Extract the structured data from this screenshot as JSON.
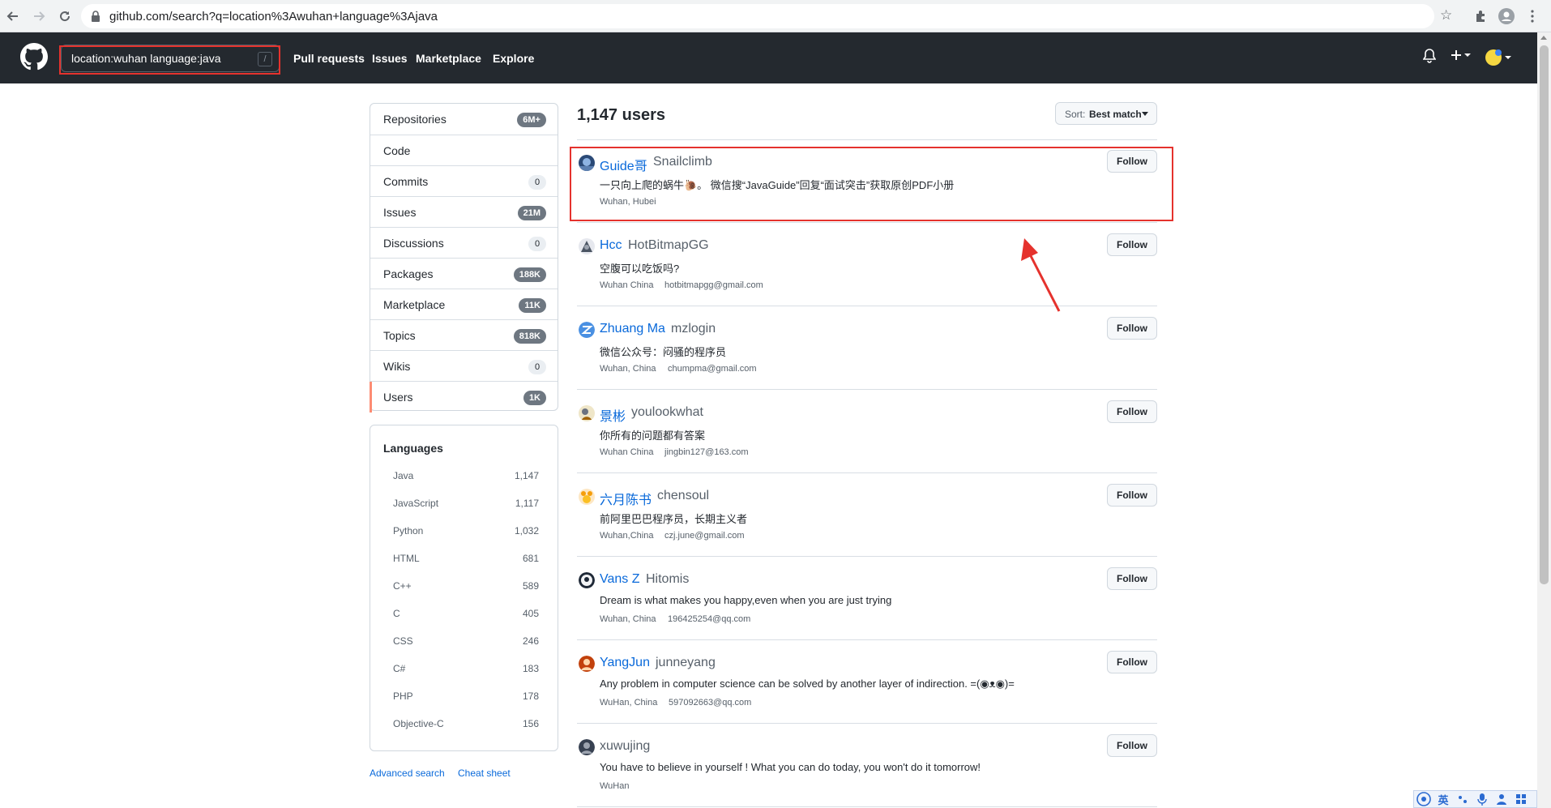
{
  "browser": {
    "url": "github.com/search?q=location%3Awuhan+language%3Ajava"
  },
  "header": {
    "search_value": "location:wuhan language:java",
    "search_key_hint": "/",
    "nav": [
      "Pull requests",
      "Issues",
      "Marketplace",
      "Explore"
    ]
  },
  "sidebar": {
    "items": [
      {
        "label": "Repositories",
        "count": "6M+"
      },
      {
        "label": "Code",
        "count": ""
      },
      {
        "label": "Commits",
        "count": "0"
      },
      {
        "label": "Issues",
        "count": "21M"
      },
      {
        "label": "Discussions",
        "count": "0"
      },
      {
        "label": "Packages",
        "count": "188K"
      },
      {
        "label": "Marketplace",
        "count": "11K"
      },
      {
        "label": "Topics",
        "count": "818K"
      },
      {
        "label": "Wikis",
        "count": "0"
      },
      {
        "label": "Users",
        "count": "1K",
        "selected": true
      }
    ],
    "languages_title": "Languages",
    "languages": [
      {
        "name": "Java",
        "count": "1,147"
      },
      {
        "name": "JavaScript",
        "count": "1,117"
      },
      {
        "name": "Python",
        "count": "1,032"
      },
      {
        "name": "HTML",
        "count": "681"
      },
      {
        "name": "C++",
        "count": "589"
      },
      {
        "name": "C",
        "count": "405"
      },
      {
        "name": "CSS",
        "count": "246"
      },
      {
        "name": "C#",
        "count": "183"
      },
      {
        "name": "PHP",
        "count": "178"
      },
      {
        "name": "Objective-C",
        "count": "156"
      }
    ],
    "advanced_search": "Advanced search",
    "cheat_sheet": "Cheat sheet"
  },
  "results": {
    "title": "1,147 users",
    "sort_label": "Sort:",
    "sort_value": "Best match",
    "follow_label": "Follow",
    "users": [
      {
        "name": "Guide哥",
        "login": "Snailclimb",
        "bio": "一只向上爬的蜗牛🐌。 微信搜“JavaGuide”回复“面试突击”获取原创PDF小册",
        "location": "Wuhan, Hubei",
        "email": ""
      },
      {
        "name": "Hcc",
        "login": "HotBitmapGG",
        "bio": "空腹可以吃饭吗?",
        "location": "Wuhan China",
        "email": "hotbitmapgg@gmail.com"
      },
      {
        "name": "Zhuang Ma",
        "login": "mzlogin",
        "bio": "微信公众号：闷骚的程序员",
        "location": "Wuhan, China",
        "email": "chumpma@gmail.com"
      },
      {
        "name": "景彬",
        "login": "youlookwhat",
        "bio": "你所有的问题都有答案",
        "location": "Wuhan China",
        "email": "jingbin127@163.com"
      },
      {
        "name": "六月陈书",
        "login": "chensoul",
        "bio": "前阿里巴巴程序员，长期主义者",
        "location": "Wuhan,China",
        "email": "czj.june@gmail.com"
      },
      {
        "name": "Vans Z",
        "login": "Hitomis",
        "bio": "Dream is what makes you happy,even when you are just trying",
        "location": "Wuhan, China",
        "email": "196425254@qq.com"
      },
      {
        "name": "YangJun",
        "login": "junneyang",
        "bio": "Any problem in computer science can be solved by another layer of indirection. =(◉ᴥ◉)=",
        "location": "WuHan, China",
        "email": "597092663@qq.com"
      },
      {
        "name": "",
        "login": "xuwujing",
        "bio": "You have to believe in yourself ! What you can do today, you won't do it tomorrow!",
        "location": "WuHan",
        "email": ""
      }
    ]
  },
  "ime": {
    "lang": "英"
  },
  "colors": {
    "header_bg": "#24292f",
    "link": "#0969da",
    "annotation_red": "#e5322d",
    "selected_accent": "#fd8c73"
  }
}
